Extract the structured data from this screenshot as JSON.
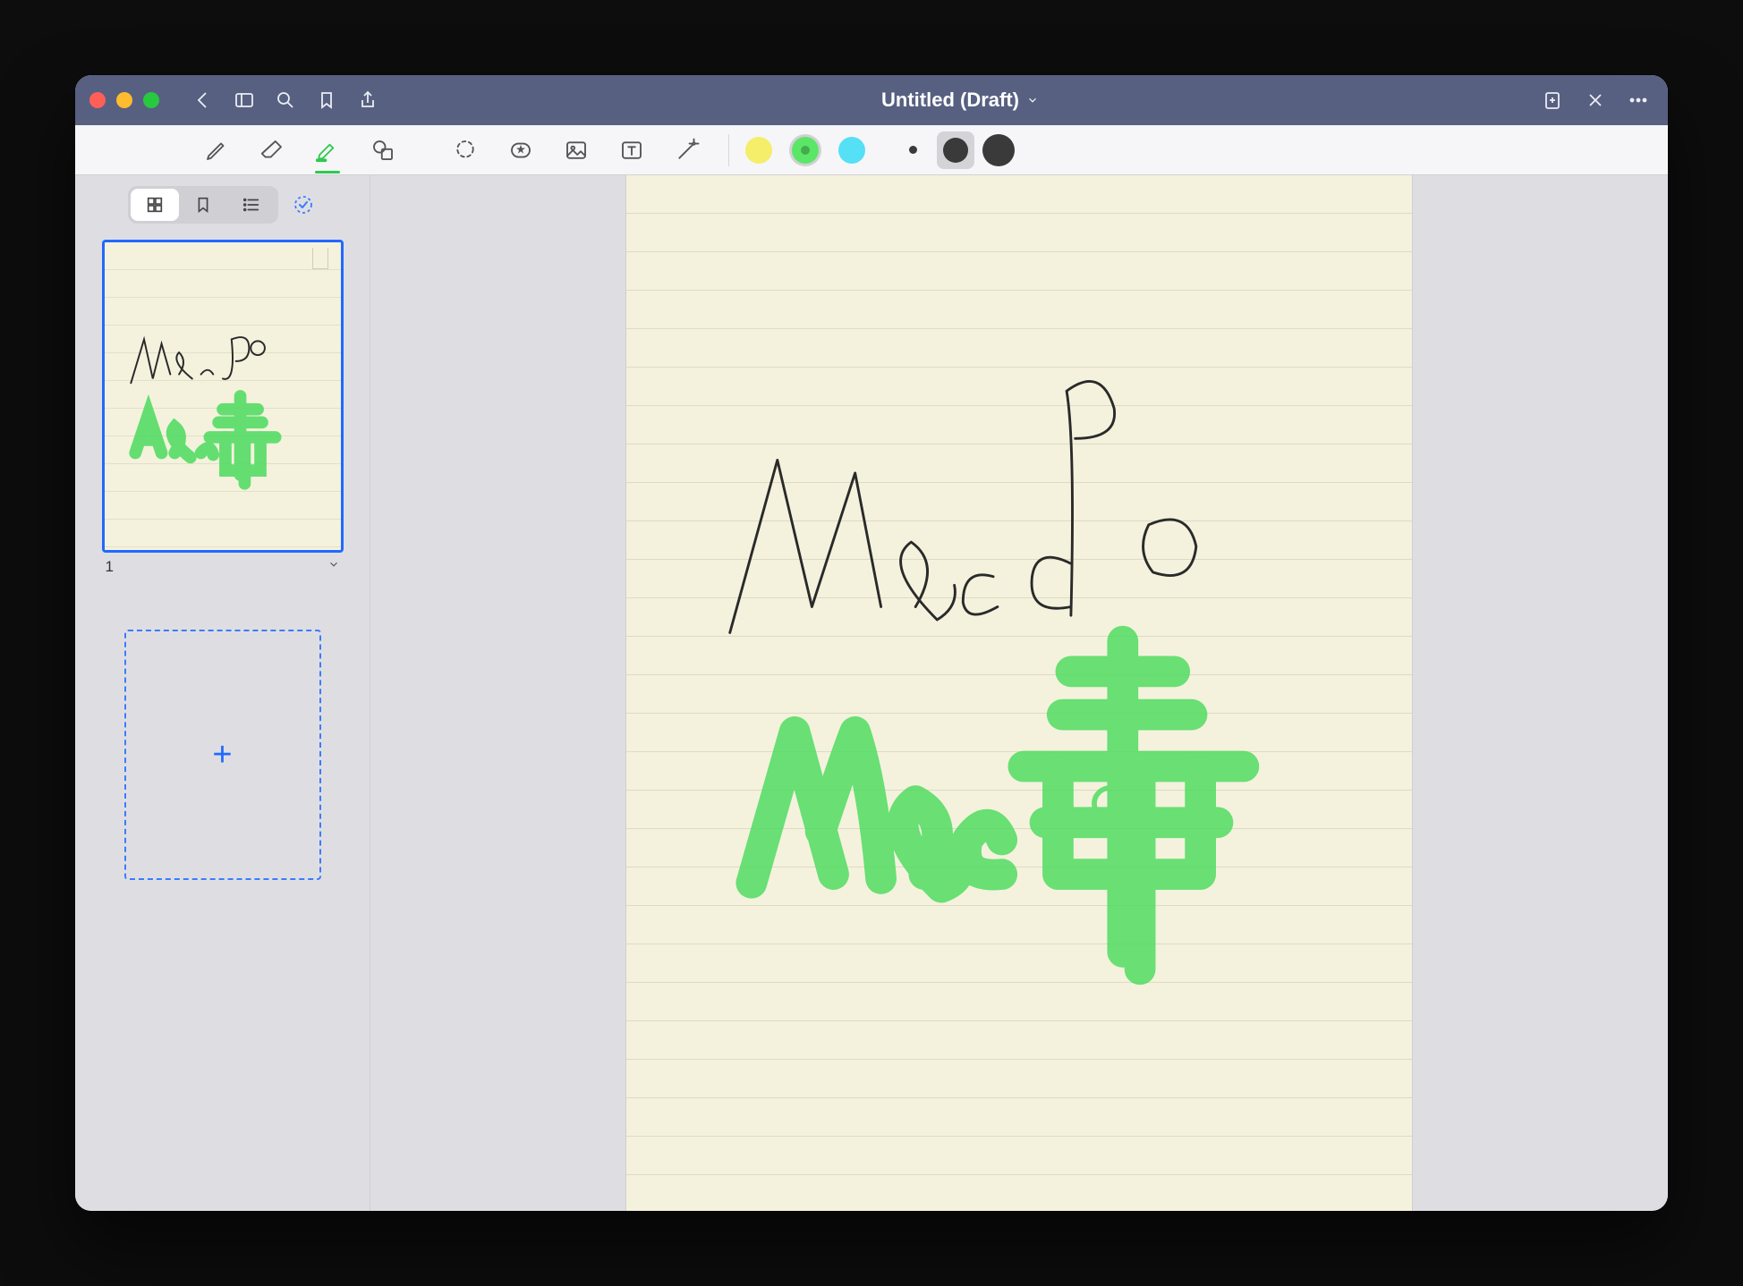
{
  "window": {
    "title": "Untitled (Draft)"
  },
  "titlebar": {
    "back": "back",
    "sidebar_toggle": "sidebar-toggle",
    "search": "search",
    "bookmark": "bookmark",
    "share": "share",
    "new_note": "new-note",
    "close": "close",
    "more": "more"
  },
  "toolbar": {
    "tools": [
      "pen",
      "eraser",
      "highlighter",
      "shape",
      "lasso",
      "sticker",
      "image",
      "text",
      "magic"
    ],
    "active_tool": "highlighter",
    "colors": [
      {
        "name": "yellow",
        "hex": "#f4ee6a"
      },
      {
        "name": "green",
        "hex": "#5be667"
      },
      {
        "name": "cyan",
        "hex": "#55e0f6"
      }
    ],
    "selected_color": "green",
    "sizes": [
      8,
      28,
      36
    ],
    "selected_size_index": 1
  },
  "sidebar": {
    "views": [
      "grid",
      "bookmarks",
      "outline"
    ],
    "active_view": "grid",
    "pages": [
      {
        "number": "1",
        "handwriting_pen": "Macdo",
        "handwriting_highlight": "Mac毒"
      }
    ],
    "add_page": "+"
  },
  "canvas": {
    "handwriting_pen": "Macdo",
    "handwriting_highlight": "Mac毒",
    "pen_color": "#2a2a2a",
    "highlight_color": "#4bdb5e"
  }
}
